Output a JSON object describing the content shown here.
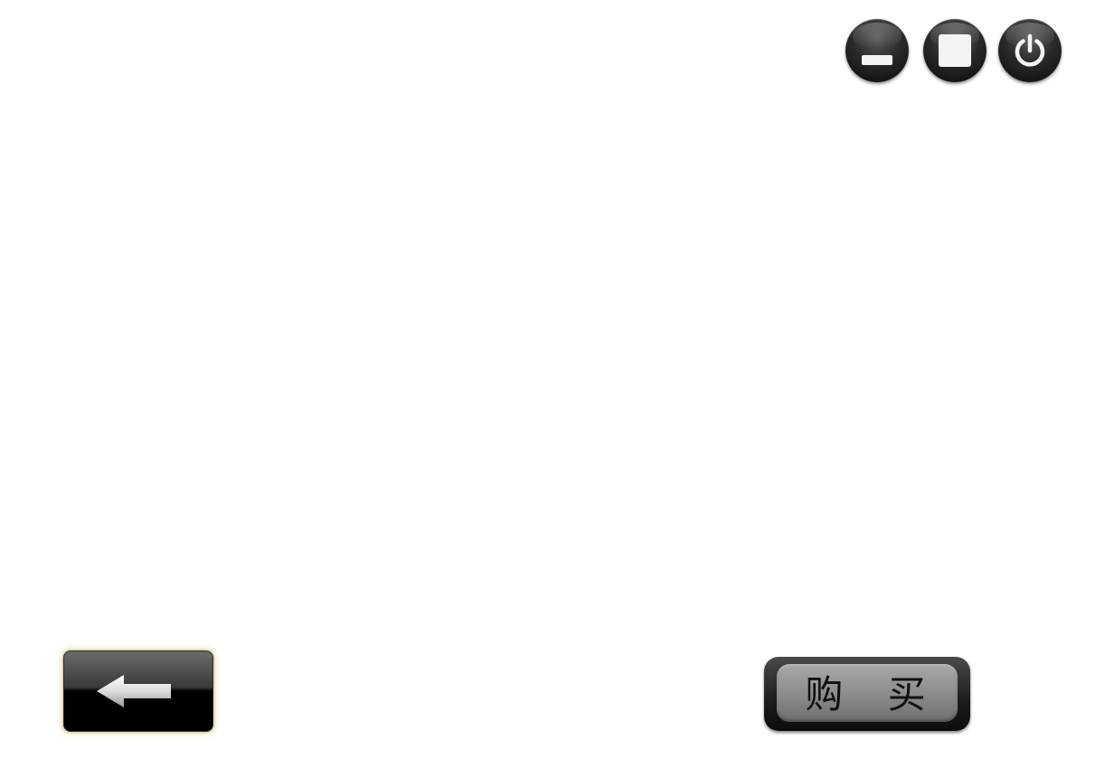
{
  "window_controls": {
    "minimize_icon": "minimize-icon",
    "maximize_icon": "maximize-icon",
    "power_icon": "power-icon"
  },
  "navigation": {
    "back_icon": "arrow-left-icon"
  },
  "actions": {
    "buy_label": "购 买"
  },
  "colors": {
    "button_dark": "#1a1a1a",
    "glyph_light": "#f4f4f4",
    "back_glow": "#e8e2aa",
    "buy_face": "#8d8d8d"
  }
}
